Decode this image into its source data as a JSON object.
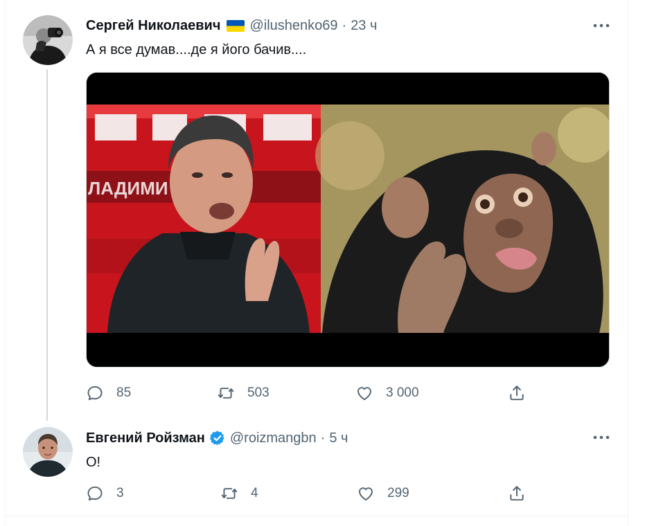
{
  "tweets": [
    {
      "name": "Сергей Николаевич",
      "handle": "@ilushenko69",
      "dot": "·",
      "time": "23 ч",
      "text": "А я все думав....де я його бачив....",
      "flag_colors": [
        "#0057b7",
        "#ffd700"
      ],
      "media": {
        "left_banner_text": "ЛАДИМИ    ОЛОВЬ",
        "left_icon": "person-photo",
        "right_icon": "chimpanzee-photo"
      },
      "actions": {
        "reply": "85",
        "retweet": "503",
        "like": "3 000"
      }
    },
    {
      "name": "Евгений Ройзман",
      "handle": "@roizmangbn",
      "dot": "·",
      "time": "5 ч",
      "text": "О!",
      "verified_color": "#1d9bf0",
      "actions": {
        "reply": "3",
        "retweet": "4",
        "like": "299"
      }
    }
  ],
  "icons": {
    "reply": "reply-icon",
    "retweet": "retweet-icon",
    "like": "like-icon",
    "share": "share-icon",
    "more": "more-icon"
  }
}
